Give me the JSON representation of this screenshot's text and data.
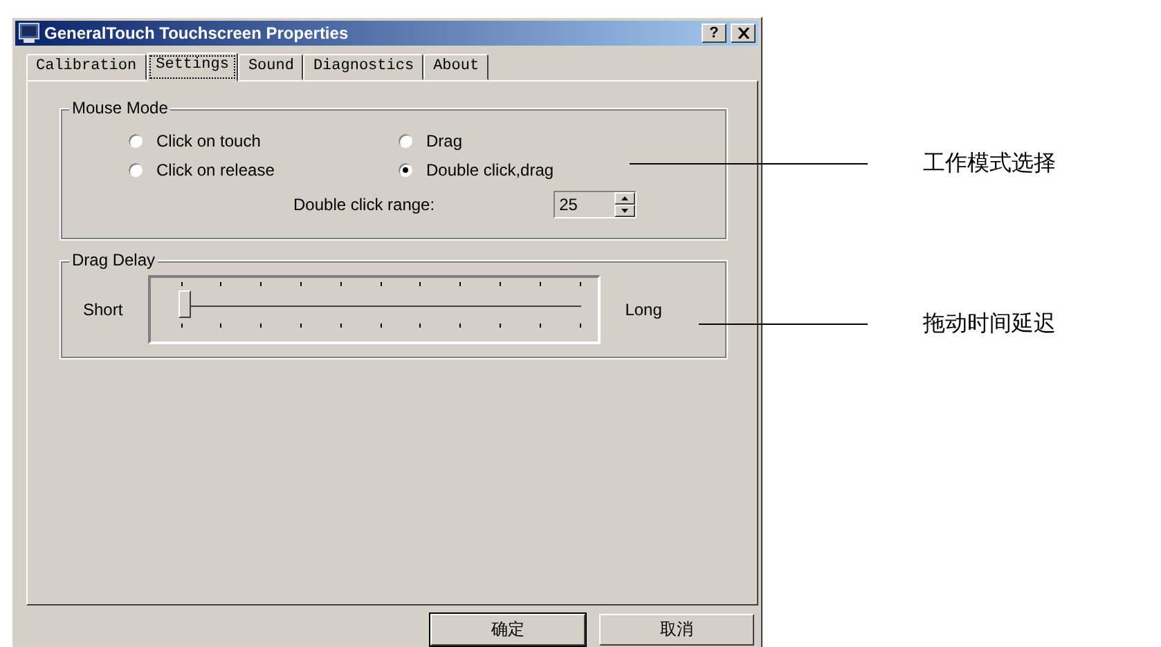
{
  "window": {
    "title": "GeneralTouch Touchscreen Properties",
    "help_button": "?"
  },
  "tabs": [
    {
      "label": "Calibration",
      "selected": false
    },
    {
      "label": "Settings",
      "selected": true
    },
    {
      "label": "Sound",
      "selected": false
    },
    {
      "label": "Diagnostics",
      "selected": false
    },
    {
      "label": "About",
      "selected": false
    }
  ],
  "mouse_mode": {
    "title": "Mouse Mode",
    "options": [
      {
        "label": "Click on touch",
        "selected": false
      },
      {
        "label": "Drag",
        "selected": false
      },
      {
        "label": "Click on release",
        "selected": false
      },
      {
        "label": "Double click,drag",
        "selected": true
      }
    ],
    "range_label": "Double click range:",
    "range_value": "25"
  },
  "drag_delay": {
    "title": "Drag Delay",
    "min_label": "Short",
    "max_label": "Long",
    "level": 0
  },
  "buttons": [
    "确定",
    "取消"
  ],
  "annotations": [
    {
      "text": "工作模式选择"
    },
    {
      "text": "拖动时间延迟"
    }
  ]
}
